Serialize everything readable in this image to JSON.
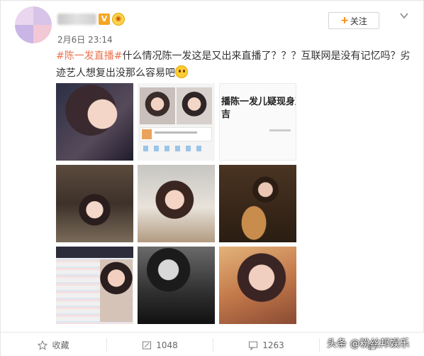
{
  "post": {
    "time": "2月6日 23:14",
    "verified_badge": "V",
    "follow_label": "关注",
    "hashtag": "#陈一发直播#",
    "text": "什么情况陈一发这是又出来直播了？？？互联网是没有记忆吗？劣迹艺人想复出没那么容易吧",
    "screenshot_caption_line1": "播陈一发儿疑现身直播",
    "screenshot_caption_line2": "吉"
  },
  "actions": {
    "favorite_label": "收藏",
    "repost_count": "1048",
    "comment_count": "1263"
  },
  "watermark": "头条 @粉丝邦娱乐",
  "colors": {
    "hashtag": "#eb7350",
    "follow_plus": "#ff8200",
    "verified": "#f5a623"
  },
  "icons": [
    "chevron-down-icon",
    "star-icon",
    "repost-icon",
    "comment-icon",
    "like-icon"
  ]
}
